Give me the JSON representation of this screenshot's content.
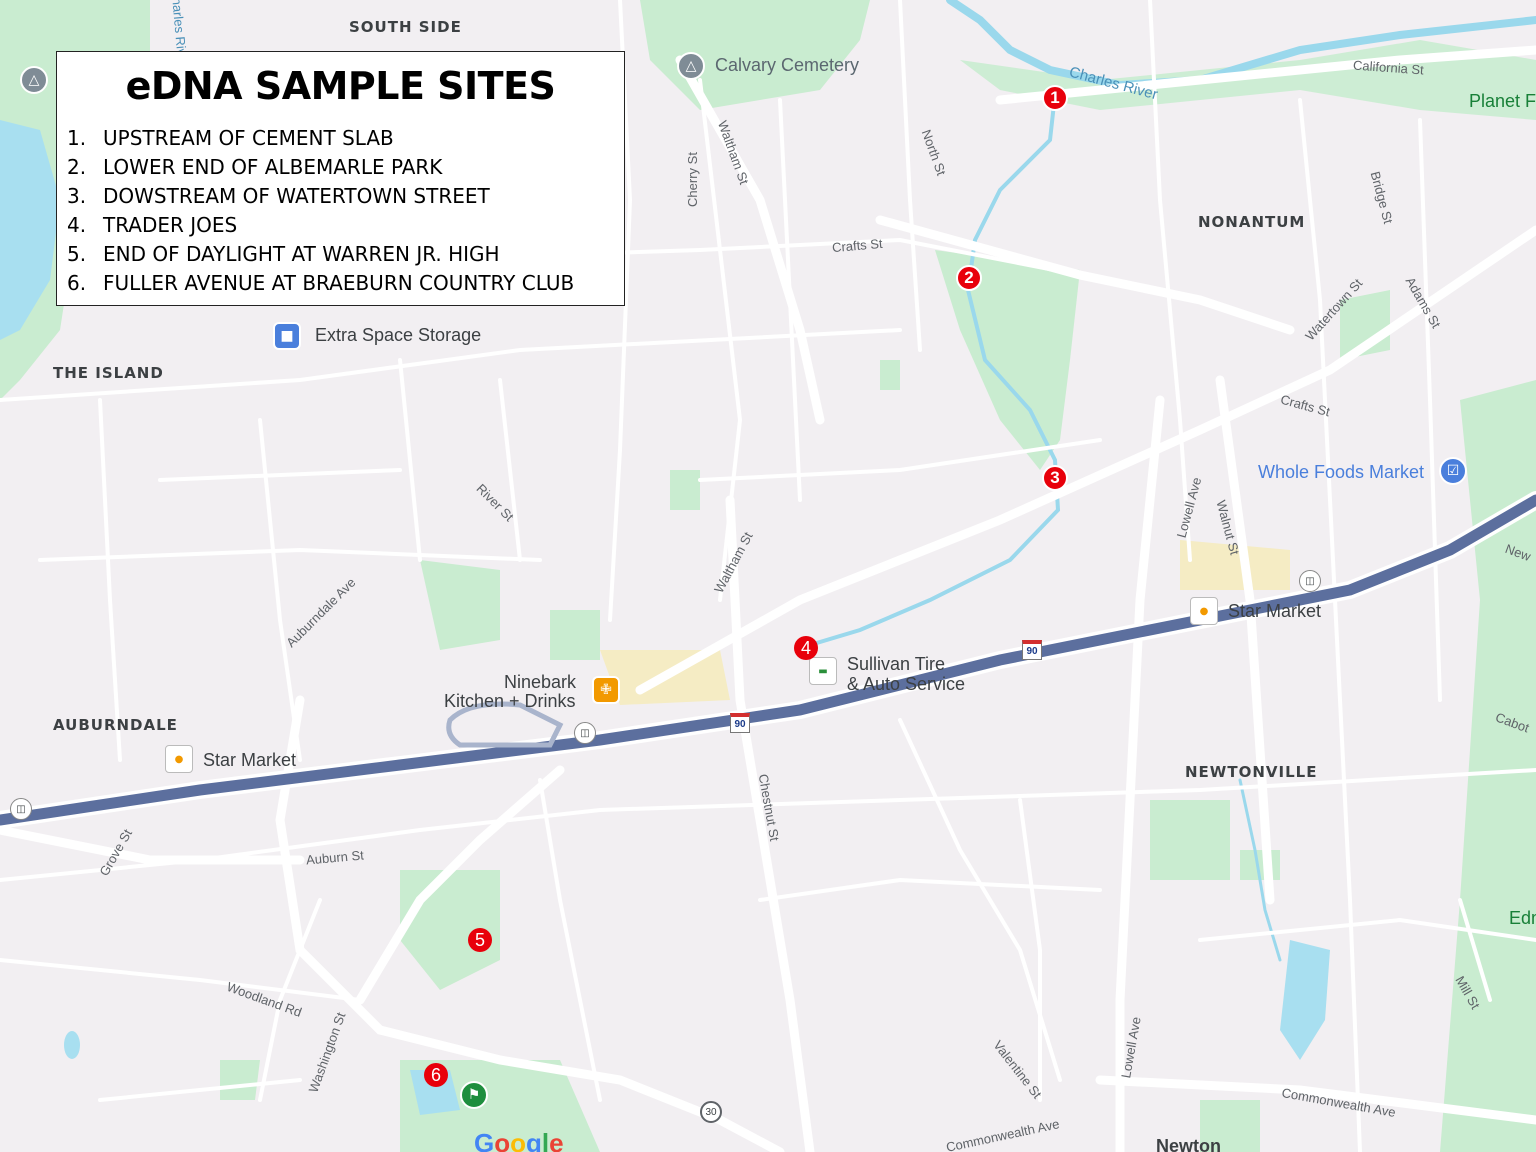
{
  "legend": {
    "title": "eDNA SAMPLE SITES",
    "items": [
      {
        "num": "1.",
        "text": "UPSTREAM OF CEMENT SLAB"
      },
      {
        "num": "2.",
        "text": "LOWER END OF ALBEMARLE PARK"
      },
      {
        "num": "3.",
        "text": "DOWSTREAM OF WATERTOWN STREET"
      },
      {
        "num": "4.",
        "text": "TRADER JOES"
      },
      {
        "num": "5.",
        "text": "END OF DAYLIGHT AT WARREN JR. HIGH"
      },
      {
        "num": "6.",
        "text": "FULLER AVENUE AT BRAEBURN COUNTRY CLUB"
      }
    ]
  },
  "markers": [
    "1",
    "2",
    "3",
    "4",
    "5",
    "6"
  ],
  "areas": {
    "south_side": "SOUTH SIDE",
    "nonantum": "NONANTUM",
    "the_island": "THE ISLAND",
    "auburndale": "AUBURNDALE",
    "newtonville": "NEWTONVILLE",
    "newton": "Newton"
  },
  "pois": {
    "calvary": "Calvary Cemetery",
    "extra_space": "Extra Space Storage",
    "whole_foods": "Whole Foods Market",
    "star_market_east": "Star Market",
    "star_market_west": "Star Market",
    "sullivan_1": "Sullivan Tire",
    "sullivan_2": "& Auto Service",
    "ninebark_1": "Ninebark",
    "ninebark_2": "Kitchen + Drinks",
    "planet": "Planet F",
    "edman": "Edman"
  },
  "streets": {
    "charles_river": "Charles River",
    "california": "California St",
    "north": "North St",
    "waltham_n": "Waltham St",
    "cherry": "Cherry St",
    "crafts_w": "Crafts St",
    "crafts_e": "Crafts St",
    "bridge": "Bridge St",
    "watertown": "Watertown St",
    "adams": "Adams St",
    "river": "River St",
    "waltham_s": "Waltham St",
    "auburndale_ave": "Auburndale Ave",
    "lowell_n": "Lowell Ave",
    "walnut": "Walnut St",
    "chestnut": "Chestnut St",
    "grove": "Grove St",
    "auburn": "Auburn St",
    "woodland": "Woodland Rd",
    "washington": "Washington St",
    "valentine": "Valentine St",
    "lowell_s": "Lowell Ave",
    "commonwealth_e": "Commonwealth Ave",
    "commonwealth_s": "Commonwealth Ave",
    "mill": "Mill St",
    "cabot": "Cabot",
    "newtonville_ave": "New",
    "charles_vert": "Charles River"
  },
  "shields": {
    "i90_a": "90",
    "i90_b": "90",
    "route30": "30"
  },
  "google_logo": "Google",
  "colors": {
    "marker": "#e8000b",
    "park": "#c9ecd0",
    "water": "#a8dff0",
    "highway": "#5c6f9e",
    "road": "#ffffff"
  }
}
